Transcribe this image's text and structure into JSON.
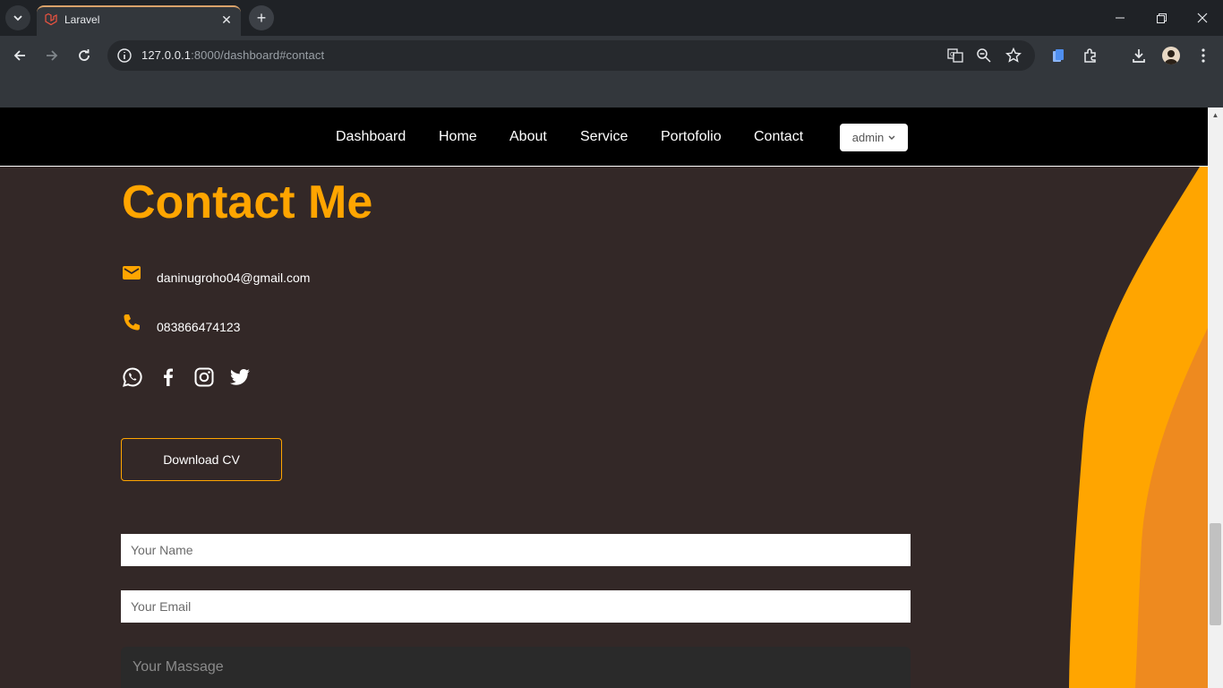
{
  "browser": {
    "tab_title": "Laravel",
    "url_host": "127.0.0.1",
    "url_rest": ":8000/dashboard#contact"
  },
  "nav": {
    "links": [
      "Dashboard",
      "Home",
      "About",
      "Service",
      "Portofolio",
      "Contact"
    ],
    "user_dropdown": "admin"
  },
  "contact": {
    "title": "Contact Me",
    "email": "daninugroho04@gmail.com",
    "phone": "083866474123",
    "social_icons": [
      "whatsapp-icon",
      "facebook-icon",
      "instagram-icon",
      "twitter-icon"
    ],
    "download_cv_label": "Download CV"
  },
  "form": {
    "name_placeholder": "Your Name",
    "email_placeholder": "Your Email",
    "message_placeholder": "Your Massage"
  },
  "colors": {
    "accent": "#ffa500",
    "accent_dark": "#ee8a1f",
    "page_bg": "#332827",
    "nav_bg": "#000000"
  }
}
